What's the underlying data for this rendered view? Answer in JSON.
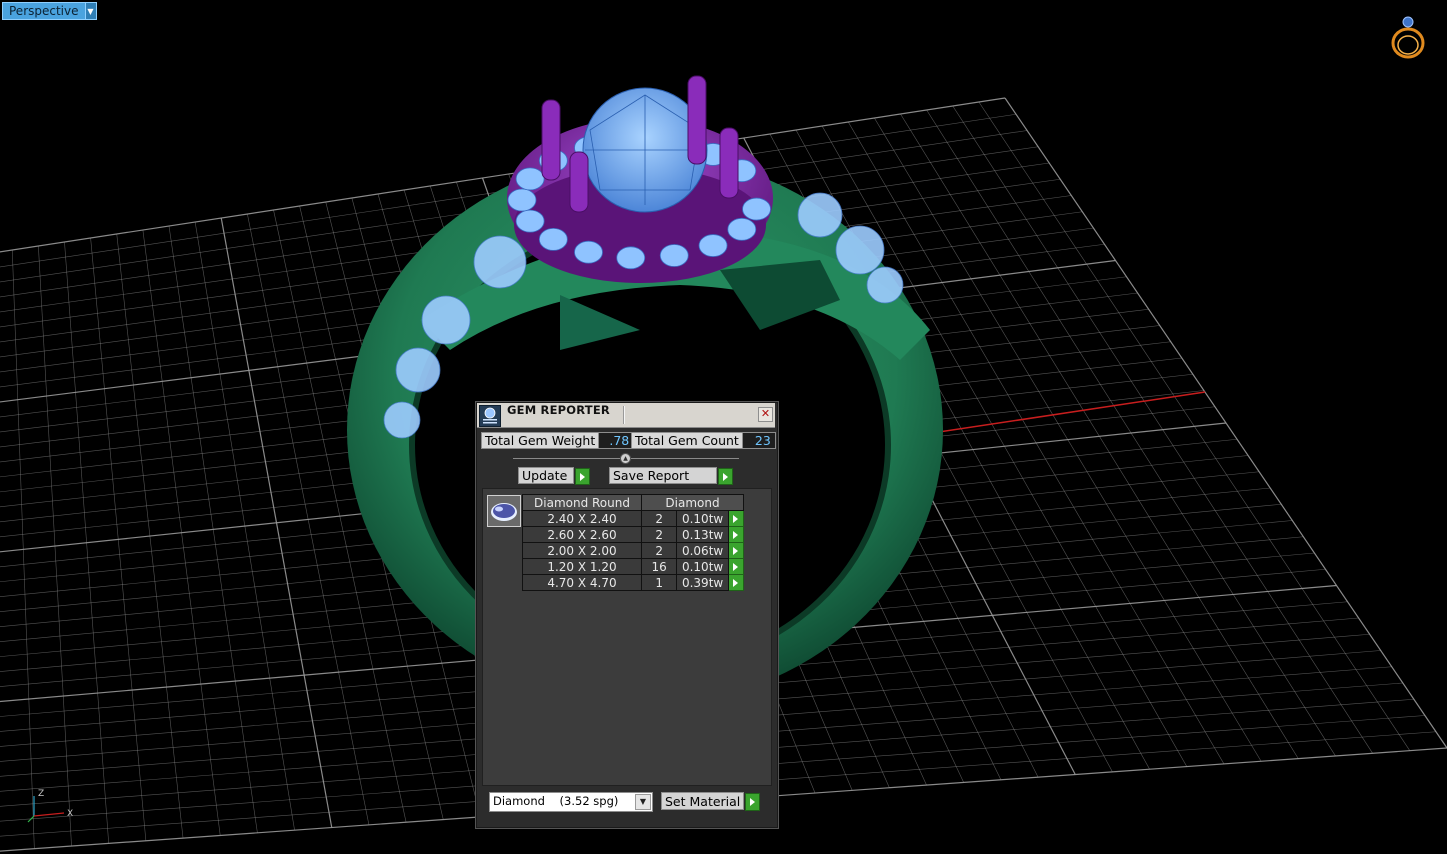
{
  "viewport": {
    "name": "Perspective",
    "axis_labels": {
      "x": "X",
      "z": "Z"
    },
    "colors": {
      "background": "#000000",
      "grid": "#9a9a9a",
      "band": "#1f7a52",
      "head": "#7a1fa0",
      "gem_wire": "#7fb8ff",
      "x_axis": "#c81e1e",
      "y_axis": "#2aa3c9"
    }
  },
  "gem_reporter": {
    "title": "GEM REPORTER",
    "total_gem_weight_label": "Total Gem Weight",
    "total_gem_weight": ".78",
    "total_gem_count_label": "Total Gem Count",
    "total_gem_count": "23",
    "update_label": "Update",
    "save_report_label": "Save Report",
    "table": {
      "headers": [
        "Diamond Round",
        "Diamond"
      ],
      "rows": [
        {
          "size": "2.40 X 2.40",
          "count": "2",
          "weight": "0.10tw"
        },
        {
          "size": "2.60 X 2.60",
          "count": "2",
          "weight": "0.13tw"
        },
        {
          "size": "2.00 X 2.00",
          "count": "2",
          "weight": "0.06tw"
        },
        {
          "size": "1.20 X 1.20",
          "count": "16",
          "weight": "0.10tw"
        },
        {
          "size": "4.70 X 4.70",
          "count": "1",
          "weight": "0.39tw"
        }
      ]
    },
    "material": "Diamond    (3.52 spg)",
    "set_material_label": "Set Material"
  }
}
